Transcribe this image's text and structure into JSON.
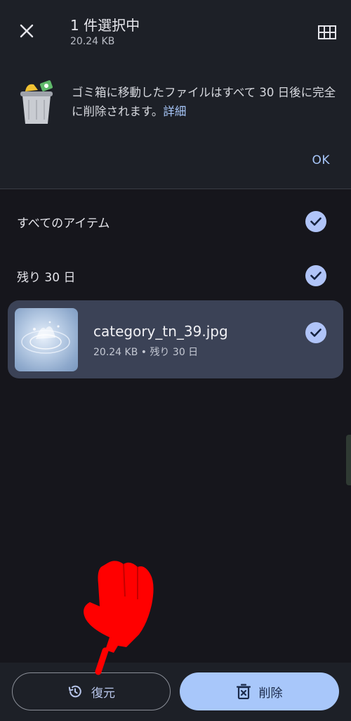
{
  "header": {
    "title": "1 件選択中",
    "subtitle": "20.24 KB",
    "close_icon": "close-icon",
    "grid_icon": "grid-view-icon"
  },
  "notice": {
    "text": "ゴミ箱に移動したファイルはすべて 30 日後に完全に削除されます。",
    "link": "詳細",
    "ok_label": "OK"
  },
  "groups": [
    {
      "label": "すべてのアイテム",
      "checked": true
    },
    {
      "label": "残り 30 日",
      "checked": true
    }
  ],
  "file": {
    "name": "category_tn_39.jpg",
    "meta": "20.24 KB • 残り 30 日",
    "checked": true
  },
  "actions": {
    "restore_label": "復元",
    "delete_label": "削除"
  },
  "colors": {
    "background": "#16161c",
    "surface": "#1d2027",
    "accent": "#a8c7fa",
    "selected_card": "#3b4256",
    "check": "#b0c4f8",
    "annotation_pointer": "#ff0000"
  }
}
